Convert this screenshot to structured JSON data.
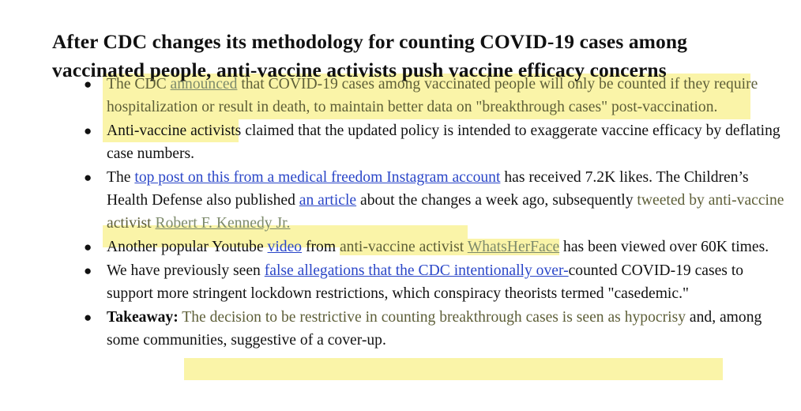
{
  "document": {
    "title": "After CDC changes its methodology for counting COVID-19 cases among vaccinated people, anti-vaccine activists push vaccine efficacy concerns",
    "bullet_marker": "●"
  },
  "colors": {
    "highlight": "#faf4a8",
    "highlight_text": "#5e5f38",
    "link_blue": "#2a46c8",
    "link_muted": "#7d8a6b",
    "body_text": "#111111",
    "background": "#ffffff"
  },
  "bullets": [
    {
      "id": "bullet-cdc-announcement",
      "highlighted": true,
      "runs": {
        "r1": "The CDC ",
        "r2": "announced",
        "r3": " that COVID-19 cases among vaccinated people will only be counted if they require hospitalization or result in death, to maintain better data on \"breakthrough cases\" post-vaccination."
      }
    },
    {
      "id": "bullet-activist-claim",
      "highlighted": false,
      "runs": {
        "r1": "Anti-vaccine activists claimed that the updated policy is intended to exaggerate vaccine efficacy by deflating case numbers."
      }
    },
    {
      "id": "bullet-top-post",
      "highlighted": false,
      "runs": {
        "r1": "The ",
        "r2": "top post on this from a medical freedom Instagram account",
        "r3": " has received 7.2K likes. The Children’s Health Defense also published ",
        "r4": "an article",
        "r5": " about the changes a week ago, subsequently ",
        "r6": "tweeted by anti-vaccine activist ",
        "r7": "Robert F. Kennedy Jr."
      }
    },
    {
      "id": "bullet-youtube-video",
      "highlighted": false,
      "runs": {
        "r1": "Another popular Youtube ",
        "r2": "video",
        "r3": " from ",
        "r4": "anti-vaccine activist ",
        "r5": "WhatsHerFace",
        "r6": " has been viewed over 60K times."
      }
    },
    {
      "id": "bullet-false-allegations",
      "highlighted": false,
      "runs": {
        "r1": "We have previously seen ",
        "r2": "false allegations that the CDC intentionally over-",
        "r3": "counted COVID-19 cases to support more stringent lockdown restrictions, which conspiracy theorists termed \"casedemic.\""
      }
    },
    {
      "id": "bullet-takeaway",
      "highlighted": true,
      "runs": {
        "r1": "Takeaway:",
        "r2": " The decision to be restrictive in counting breakthrough cases is seen as hypocrisy",
        "r3": " and, among some communities, suggestive of a cover-up."
      }
    }
  ]
}
